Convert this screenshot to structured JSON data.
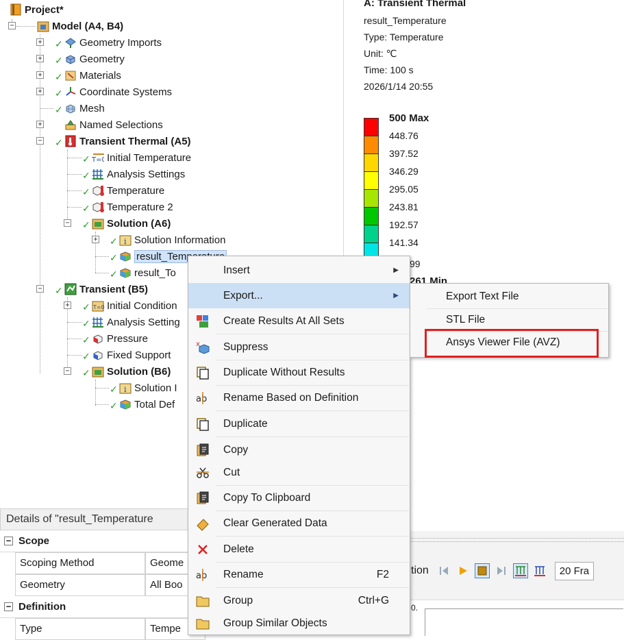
{
  "tree": {
    "items": [
      {
        "label": "Project*",
        "bold": true
      },
      {
        "label": "Model (A4, B4)",
        "bold": true
      },
      {
        "label": "Geometry Imports"
      },
      {
        "label": "Geometry"
      },
      {
        "label": "Materials"
      },
      {
        "label": "Coordinate Systems"
      },
      {
        "label": "Mesh"
      },
      {
        "label": "Named Selections"
      },
      {
        "label": "Transient Thermal (A5)",
        "bold": true
      },
      {
        "label": "Initial Temperature"
      },
      {
        "label": "Analysis Settings"
      },
      {
        "label": "Temperature"
      },
      {
        "label": "Temperature 2"
      },
      {
        "label": "Solution (A6)",
        "bold": true
      },
      {
        "label": "Solution Information"
      },
      {
        "label": "result_Temperature",
        "selected": true
      },
      {
        "label": "result_To"
      },
      {
        "label": "Transient (B5)",
        "bold": true
      },
      {
        "label": "Initial Condition"
      },
      {
        "label": "Analysis Setting"
      },
      {
        "label": "Pressure"
      },
      {
        "label": "Fixed Support"
      },
      {
        "label": "Solution (B6)",
        "bold": true
      },
      {
        "label": "Solution I"
      },
      {
        "label": "Total Def"
      }
    ]
  },
  "result_info": {
    "title": "A: Transient Thermal",
    "name": "result_Temperature",
    "type": "Type: Temperature",
    "unit": "Unit: ℃",
    "time": "Time: 100 s",
    "date": "2026/1/14 20:55"
  },
  "legend": {
    "max_label": "500 Max",
    "values": [
      "448.76",
      "397.52",
      "346.29",
      "295.05",
      "243.81",
      "192.57",
      "141.34",
      "99"
    ],
    "min_label_partial": "261 Min",
    "colors": [
      "#ff0000",
      "#ff8c00",
      "#ffd700",
      "#ffff00",
      "#a6e600",
      "#00c800",
      "#00d28c",
      "#00e6e6",
      "#00a8ff"
    ]
  },
  "details": {
    "title": "Details of \"result_Temperature",
    "rows": [
      {
        "category": "Scope"
      },
      {
        "name": "Scoping Method",
        "value": "Geome"
      },
      {
        "name": "Geometry",
        "value": "All Boo"
      },
      {
        "category": "Definition"
      },
      {
        "name": "Type",
        "value": "Tempe"
      }
    ]
  },
  "toolbar": {
    "partial_label": "tion",
    "frames": "20 Fra",
    "partial_text2": "0."
  },
  "context_menu": {
    "items": [
      {
        "label": "Insert",
        "arrow": "▶",
        "icon": ""
      },
      {
        "label": "Export...",
        "arrow": "▶",
        "icon": "",
        "highlight": true
      },
      {
        "label": "Create Results At All Sets",
        "icon": "results-icon"
      },
      {
        "label": "Suppress",
        "icon": "suppress-icon"
      },
      {
        "label": "Duplicate Without Results",
        "icon": "duplicate-icon"
      },
      {
        "label": "Rename Based on Definition",
        "icon": "rename-icon"
      },
      {
        "label": "Duplicate",
        "icon": "duplicate-icon"
      },
      {
        "label": "Copy",
        "icon": "copy-icon"
      },
      {
        "label": "Cut",
        "icon": "cut-icon"
      },
      {
        "label": "Copy To Clipboard",
        "icon": "clipboard-icon"
      },
      {
        "label": "Clear Generated Data",
        "icon": "eraser-icon"
      },
      {
        "label": "Delete",
        "icon": "delete-icon"
      },
      {
        "label": "Rename",
        "shortcut": "F2",
        "icon": "rename-icon"
      },
      {
        "label": "Group",
        "shortcut": "Ctrl+G",
        "icon": "folder-icon"
      },
      {
        "label": "Group Similar Objects",
        "icon": "folder-icon"
      }
    ]
  },
  "submenu": {
    "items": [
      {
        "label": "Export Text File"
      },
      {
        "label": "STL File"
      },
      {
        "label": "Ansys Viewer File (AVZ)",
        "boxed": true
      }
    ],
    "box_color": "#e02020"
  }
}
